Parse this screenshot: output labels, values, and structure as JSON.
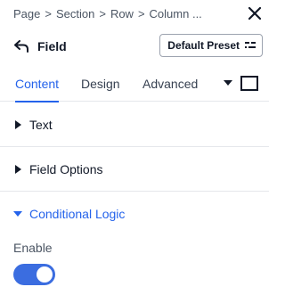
{
  "breadcrumb": {
    "items": [
      "Page",
      "Section",
      "Row",
      "Column ..."
    ],
    "separator": ">"
  },
  "header": {
    "title": "Field",
    "preset_label": "Default Preset"
  },
  "tabs": [
    {
      "label": "Content",
      "active": true
    },
    {
      "label": "Design",
      "active": false
    },
    {
      "label": "Advanced",
      "active": false
    }
  ],
  "sections": {
    "text": {
      "label": "Text",
      "expanded": false
    },
    "field_options": {
      "label": "Field Options",
      "expanded": false
    },
    "conditional_logic": {
      "label": "Conditional Logic",
      "expanded": true
    }
  },
  "conditional_logic": {
    "enable_label": "Enable",
    "enable_value": true
  },
  "icons": {
    "close": "close-icon",
    "back": "back-arrow-icon",
    "preset": "preset-options-icon",
    "tab_dropdown": "caret-down-icon",
    "tab_square": "square-icon"
  },
  "colors": {
    "accent": "#2563eb",
    "toggle_on": "#3b6de0",
    "text": "#111827",
    "muted": "#4b5563",
    "divider": "#e5e7eb"
  }
}
